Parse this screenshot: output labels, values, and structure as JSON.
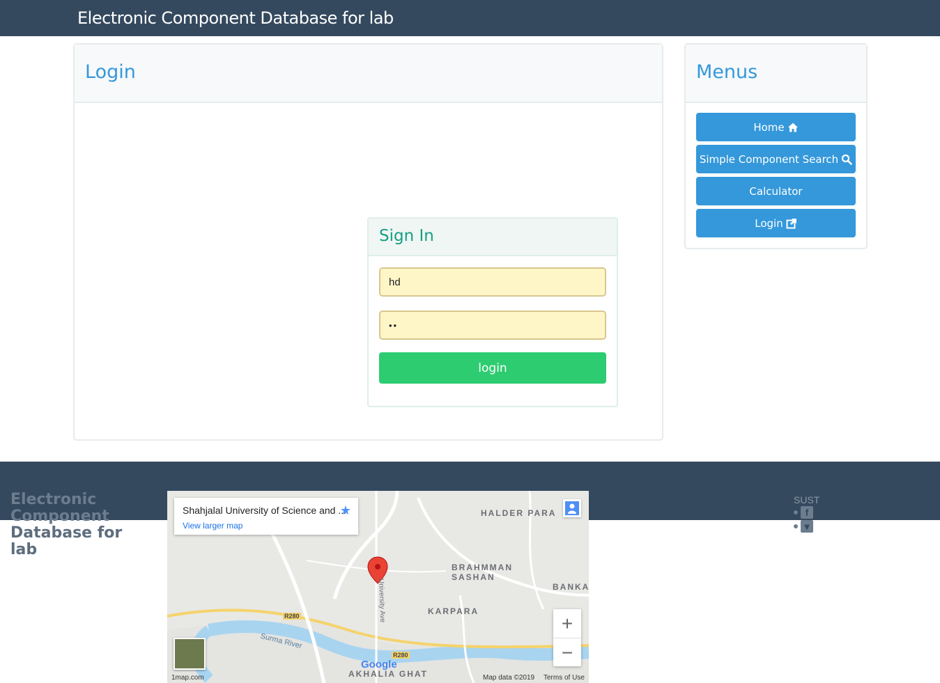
{
  "header": {
    "brand": "Electronic Component Database for lab"
  },
  "login_panel": {
    "title": "Login"
  },
  "signin": {
    "title": "Sign In",
    "username_value": "hd",
    "password_mask": "••",
    "login_label": "login"
  },
  "menus": {
    "title": "Menus",
    "items": [
      {
        "label": "Home",
        "icon": "home-icon"
      },
      {
        "label": "Simple Component Search",
        "icon": "search-icon"
      },
      {
        "label": "Calculator",
        "icon": ""
      },
      {
        "label": "Login",
        "icon": "external-link-icon"
      }
    ]
  },
  "footer": {
    "brand_line1": "Electronic",
    "brand_line2": "Component",
    "brand_line3": "Database for lab",
    "social_heading": "SUST",
    "social_icons": [
      "facebook-icon",
      "comment-icon"
    ]
  },
  "map": {
    "place_title": "Shahjalal University of Science and ...",
    "larger_map_link": "View larger map",
    "labels": [
      "HALDER PARA",
      "BRAHMMAN SASHAN",
      "KARPARA",
      "AKHALIA GHAT",
      "BANKA",
      "Surma River",
      "University Ave",
      "R280",
      "R280"
    ],
    "zoom_in": "+",
    "zoom_out": "−",
    "watermark": "Google",
    "credit_left": "1map.com",
    "map_data": "Map data ©2019",
    "terms": "Terms of Use"
  }
}
